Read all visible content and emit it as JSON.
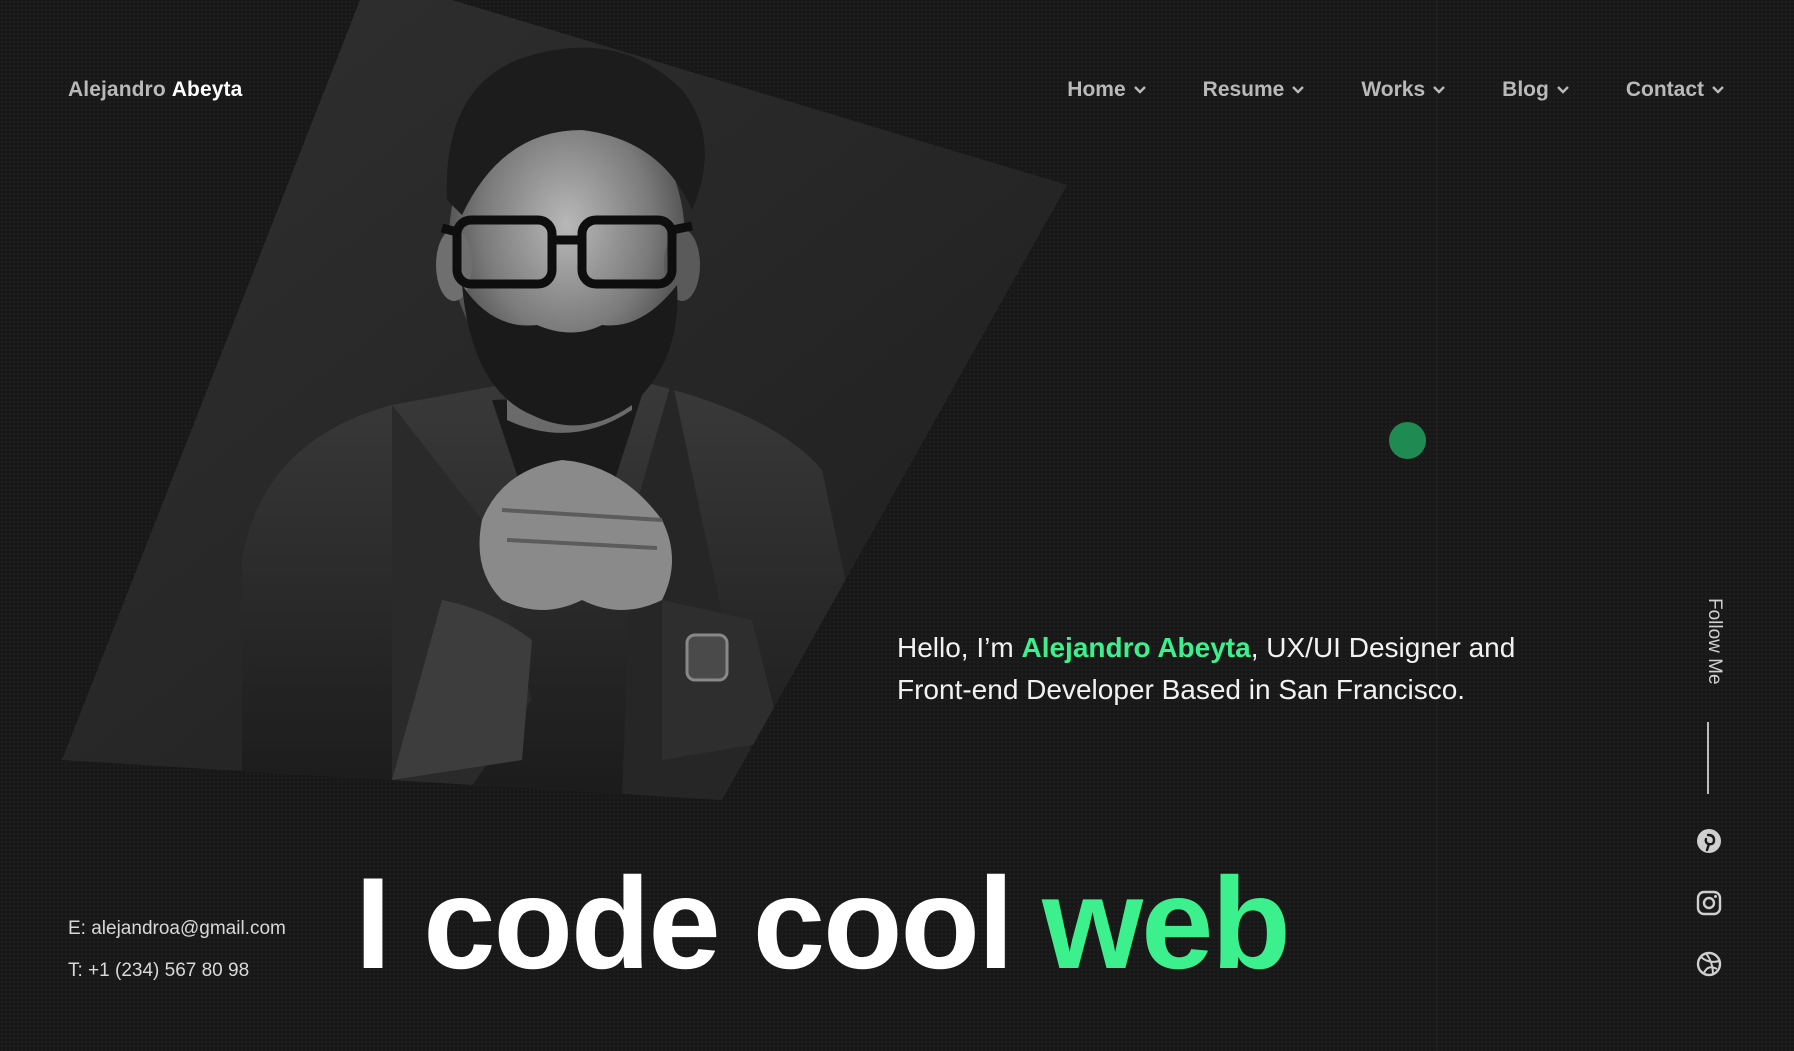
{
  "brand": {
    "first": "Alejandro",
    "last": "Abeyta"
  },
  "nav": [
    {
      "label": "Home",
      "icon": "chevron-down-icon"
    },
    {
      "label": "Resume",
      "icon": "chevron-down-icon"
    },
    {
      "label": "Works",
      "icon": "chevron-down-icon"
    },
    {
      "label": "Blog",
      "icon": "chevron-down-icon"
    },
    {
      "label": "Contact",
      "icon": "chevron-down-icon"
    }
  ],
  "intro": {
    "prefix": "Hello, I’m ",
    "name": "Alejandro Abeyta",
    "suffix": ", UX/UI Designer and Front-end Developer Based in San Francisco."
  },
  "headline": {
    "white": "I code cool",
    "green": "web"
  },
  "contact": {
    "email": "E: alejandroa@gmail.com",
    "phone": "T: +1 (234) 567 80 98"
  },
  "social": {
    "label": "Follow Me",
    "icons": [
      "pinterest-icon",
      "instagram-icon",
      "dribbble-icon"
    ]
  },
  "colors": {
    "accent": "#3cf08e",
    "background": "#181818",
    "dot": "#1f8a52"
  }
}
